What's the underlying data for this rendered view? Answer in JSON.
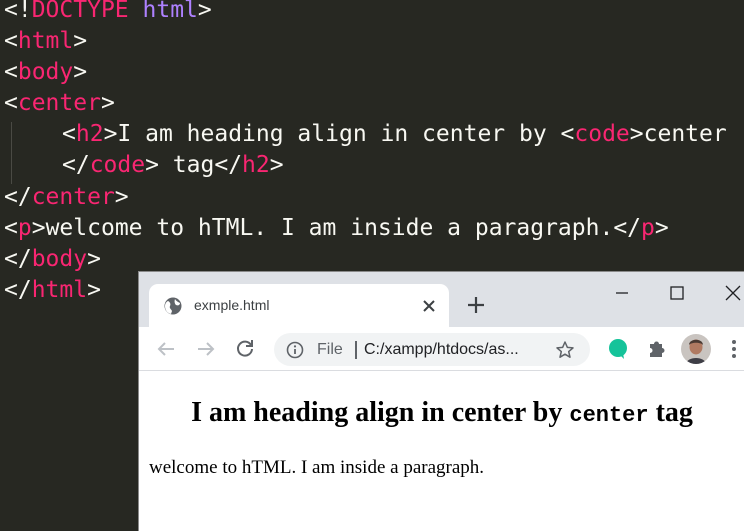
{
  "colors": {
    "editor_background": "#272822",
    "editor_text": "#f8f8f2",
    "tag_name": "#f92672",
    "doctype_keyword": "#ae81ff",
    "browser_chrome": "#dee1e6"
  },
  "editor": {
    "line1": {
      "open": "<!",
      "doctype": "DOCTYPE",
      "space": " ",
      "html": "html",
      "close": ">"
    },
    "line2": {
      "open": "<",
      "tag": "html",
      "close": ">"
    },
    "line3": {
      "open": "<",
      "tag": "body",
      "close": ">"
    },
    "line4": {
      "open": "<",
      "tag": "center",
      "close": ">"
    },
    "line5": {
      "open": "<",
      "tag": "h2",
      "close": ">",
      "text": "I am heading align in center by ",
      "open2": "<",
      "tag2": "code",
      "close2": ">",
      "text2": "center"
    },
    "line6": {
      "open": "</",
      "tag": "code",
      "close": ">",
      "text": " tag",
      "open2": "</",
      "tag2": "h2",
      "close2": ">"
    },
    "line7": {
      "open": "</",
      "tag": "center",
      "close": ">"
    },
    "line8": {
      "open": "<",
      "tag": "p",
      "close": ">",
      "text": "welcome to hTML. I am inside a paragraph.",
      "open2": "</",
      "tag2": "p",
      "close2": ">"
    },
    "line9": {
      "open": "</",
      "tag": "body",
      "close": ">"
    },
    "line10": {
      "open": "</",
      "tag": "html",
      "close": ">"
    }
  },
  "browser": {
    "tab": {
      "title": "exmple.html",
      "favicon": "globe-icon"
    },
    "toolbar": {
      "scheme_label": "File",
      "separator": "|",
      "url": "C:/xampp/htdocs/as...",
      "icons": [
        "back-arrow-icon",
        "forward-arrow-icon",
        "reload-icon",
        "info-icon",
        "star-icon",
        "grammarly-icon",
        "puzzle-icon",
        "avatar",
        "menu-icon"
      ]
    },
    "page": {
      "heading_text": "I am heading align in center by ",
      "heading_code": "center",
      "heading_suffix": " tag",
      "paragraph": "welcome to hTML. I am inside a paragraph."
    }
  }
}
